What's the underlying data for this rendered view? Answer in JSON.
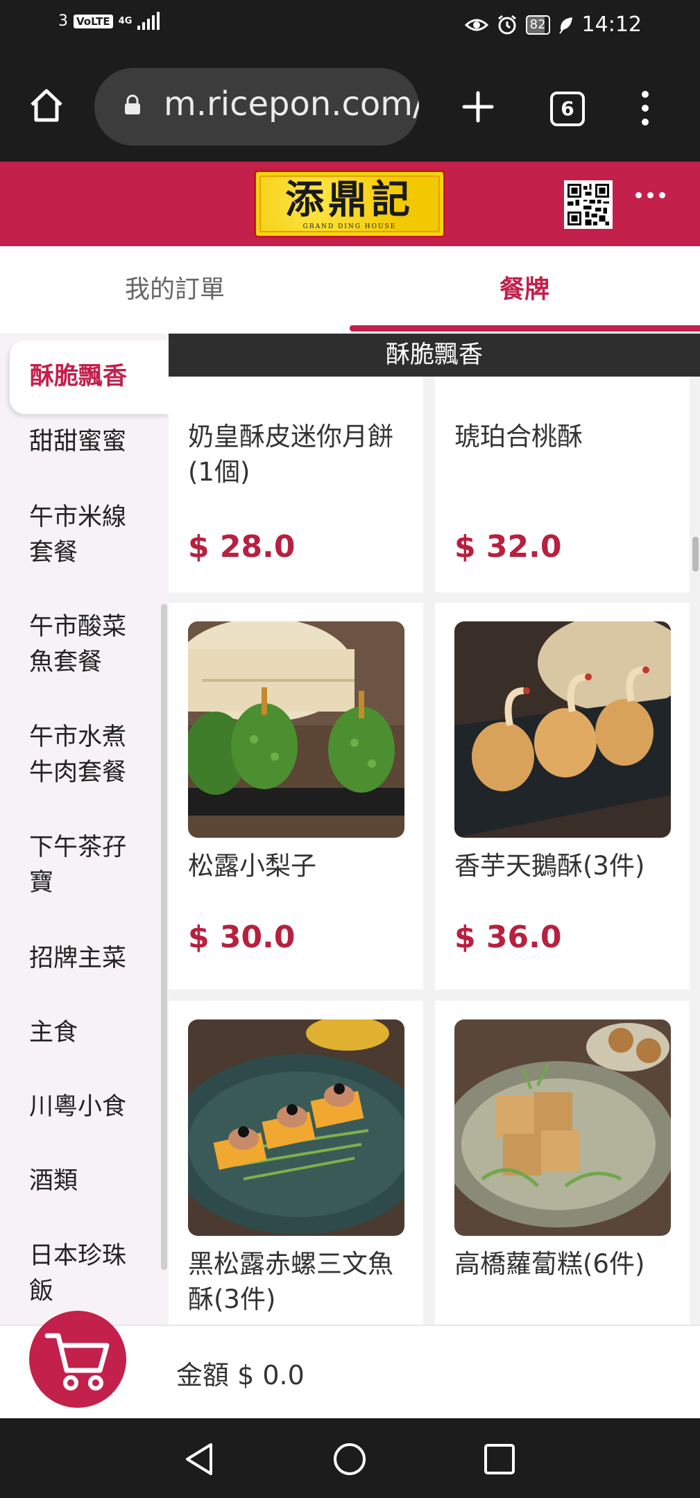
{
  "status_bar": {
    "sim": "3",
    "volte": "VoLTE",
    "network": "4G",
    "battery": "82",
    "time": "14:12"
  },
  "browser": {
    "url": "m.ricepon.com/",
    "tab_count": "6",
    "icons": [
      "home-icon",
      "lock-icon",
      "new-tab-icon",
      "tabs-icon",
      "more-vert-icon"
    ]
  },
  "header": {
    "logo_text": "添鼎記",
    "logo_subtext": "GRAND  DING  HOUSE",
    "brand_color": "#c3204c"
  },
  "tabs": [
    {
      "label": "我的訂單",
      "active": false
    },
    {
      "label": "餐牌",
      "active": true
    }
  ],
  "sidebar": {
    "items": [
      {
        "label": "酥脆飄香",
        "active": true
      },
      {
        "label": "甜甜蜜蜜"
      },
      {
        "label": "午市米線套餐"
      },
      {
        "label": "午市酸菜魚套餐"
      },
      {
        "label": "午市水煮牛肉套餐"
      },
      {
        "label": "下午茶孖寶"
      },
      {
        "label": "招牌主菜"
      },
      {
        "label": "主食"
      },
      {
        "label": "川粵小食"
      },
      {
        "label": "酒類"
      },
      {
        "label": "日本珍珠飯"
      }
    ]
  },
  "menu": {
    "section_title": "酥脆飄香",
    "items": [
      {
        "name": "奶皇酥皮迷你月餅(1個)",
        "price": "$ 28.0"
      },
      {
        "name": "琥珀合桃酥",
        "price": "$ 32.0"
      },
      {
        "name": "松露小梨子",
        "price": "$ 30.0"
      },
      {
        "name": "香芋天鵝酥(3件)",
        "price": "$ 36.0"
      },
      {
        "name": "黑松露赤螺三文魚酥(3件)",
        "price": ""
      },
      {
        "name": "高橋蘿蔔糕(6件)",
        "price": ""
      }
    ]
  },
  "cart": {
    "amount_label": "金額 $ 0.0"
  },
  "nav": {
    "icons": [
      "back-icon",
      "home-circle-icon",
      "recents-icon"
    ]
  }
}
